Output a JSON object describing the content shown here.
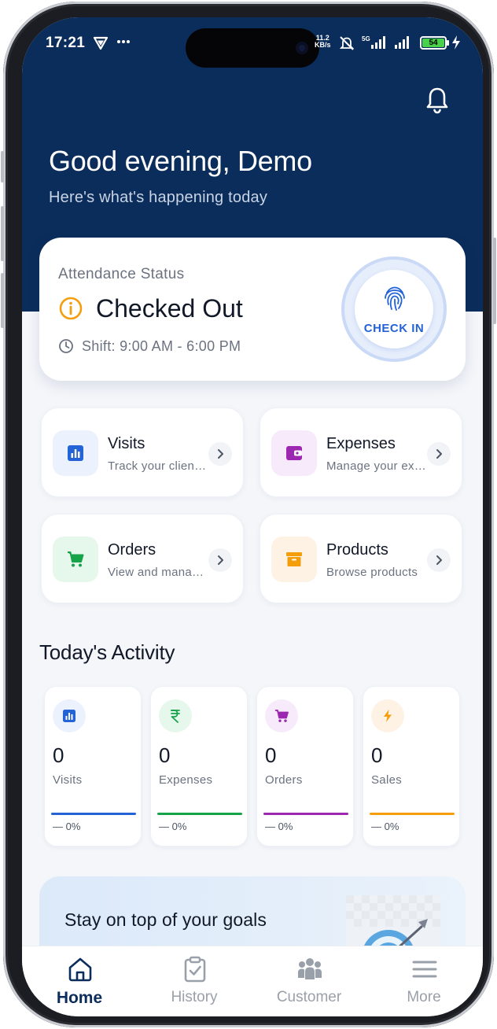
{
  "status_bar": {
    "time": "17:21",
    "network_speed": "11.2\nKB/s",
    "battery": "54",
    "icons": [
      "vpn-icon",
      "more-dots-icon",
      "mute-icon",
      "signal-5g-icon",
      "signal-icon",
      "battery-icon",
      "charging-icon"
    ]
  },
  "header": {
    "greeting": "Good evening, Demo",
    "subtitle": "Here's what's happening today"
  },
  "attendance": {
    "label": "Attendance Status",
    "status": "Checked Out",
    "shift": "Shift: 9:00 AM - 6:00 PM",
    "check_in_label": "CHECK IN"
  },
  "quick_actions": [
    {
      "title": "Visits",
      "subtitle": "Track your client visits",
      "icon": "bar-chart-icon",
      "color": "#2463d6",
      "bg": "#ebf1fd"
    },
    {
      "title": "Expenses",
      "subtitle": "Manage your expenses",
      "icon": "wallet-icon",
      "color": "#9c27b0",
      "bg": "#f7eafb"
    },
    {
      "title": "Orders",
      "subtitle": "View and manage orders",
      "icon": "cart-icon",
      "color": "#16a34a",
      "bg": "#e6f7ec"
    },
    {
      "title": "Products",
      "subtitle": "Browse products",
      "icon": "archive-box-icon",
      "color": "#f59e0b",
      "bg": "#fdf2e3"
    }
  ],
  "activity": {
    "title": "Today's Activity",
    "items": [
      {
        "value": "0",
        "label": "Visits",
        "change": "— 0%",
        "icon": "bar-chart-icon",
        "color": "#2463d6",
        "bg": "#ebf1fd"
      },
      {
        "value": "0",
        "label": "Expenses",
        "change": "— 0%",
        "icon": "rupee-icon",
        "color": "#16a34a",
        "bg": "#e6f7ec"
      },
      {
        "value": "0",
        "label": "Orders",
        "change": "— 0%",
        "icon": "cart-icon",
        "color": "#9c27b0",
        "bg": "#f7eafb"
      },
      {
        "value": "0",
        "label": "Sales",
        "change": "— 0%",
        "icon": "lightning-icon",
        "color": "#f59e0b",
        "bg": "#fdf2e3"
      }
    ]
  },
  "goal_banner": {
    "text": "Stay on top of your goals",
    "image": "target-dart-icon"
  },
  "tabbar": {
    "tabs": [
      {
        "label": "Home",
        "icon": "home-icon",
        "active": true
      },
      {
        "label": "History",
        "icon": "clipboard-check-icon",
        "active": false
      },
      {
        "label": "Customer",
        "icon": "users-icon",
        "active": false
      },
      {
        "label": "More",
        "icon": "menu-icon",
        "active": false
      }
    ]
  },
  "colors": {
    "header_bg": "#0b2d5b",
    "primary": "#2463d6",
    "warning": "#f59e0b"
  }
}
